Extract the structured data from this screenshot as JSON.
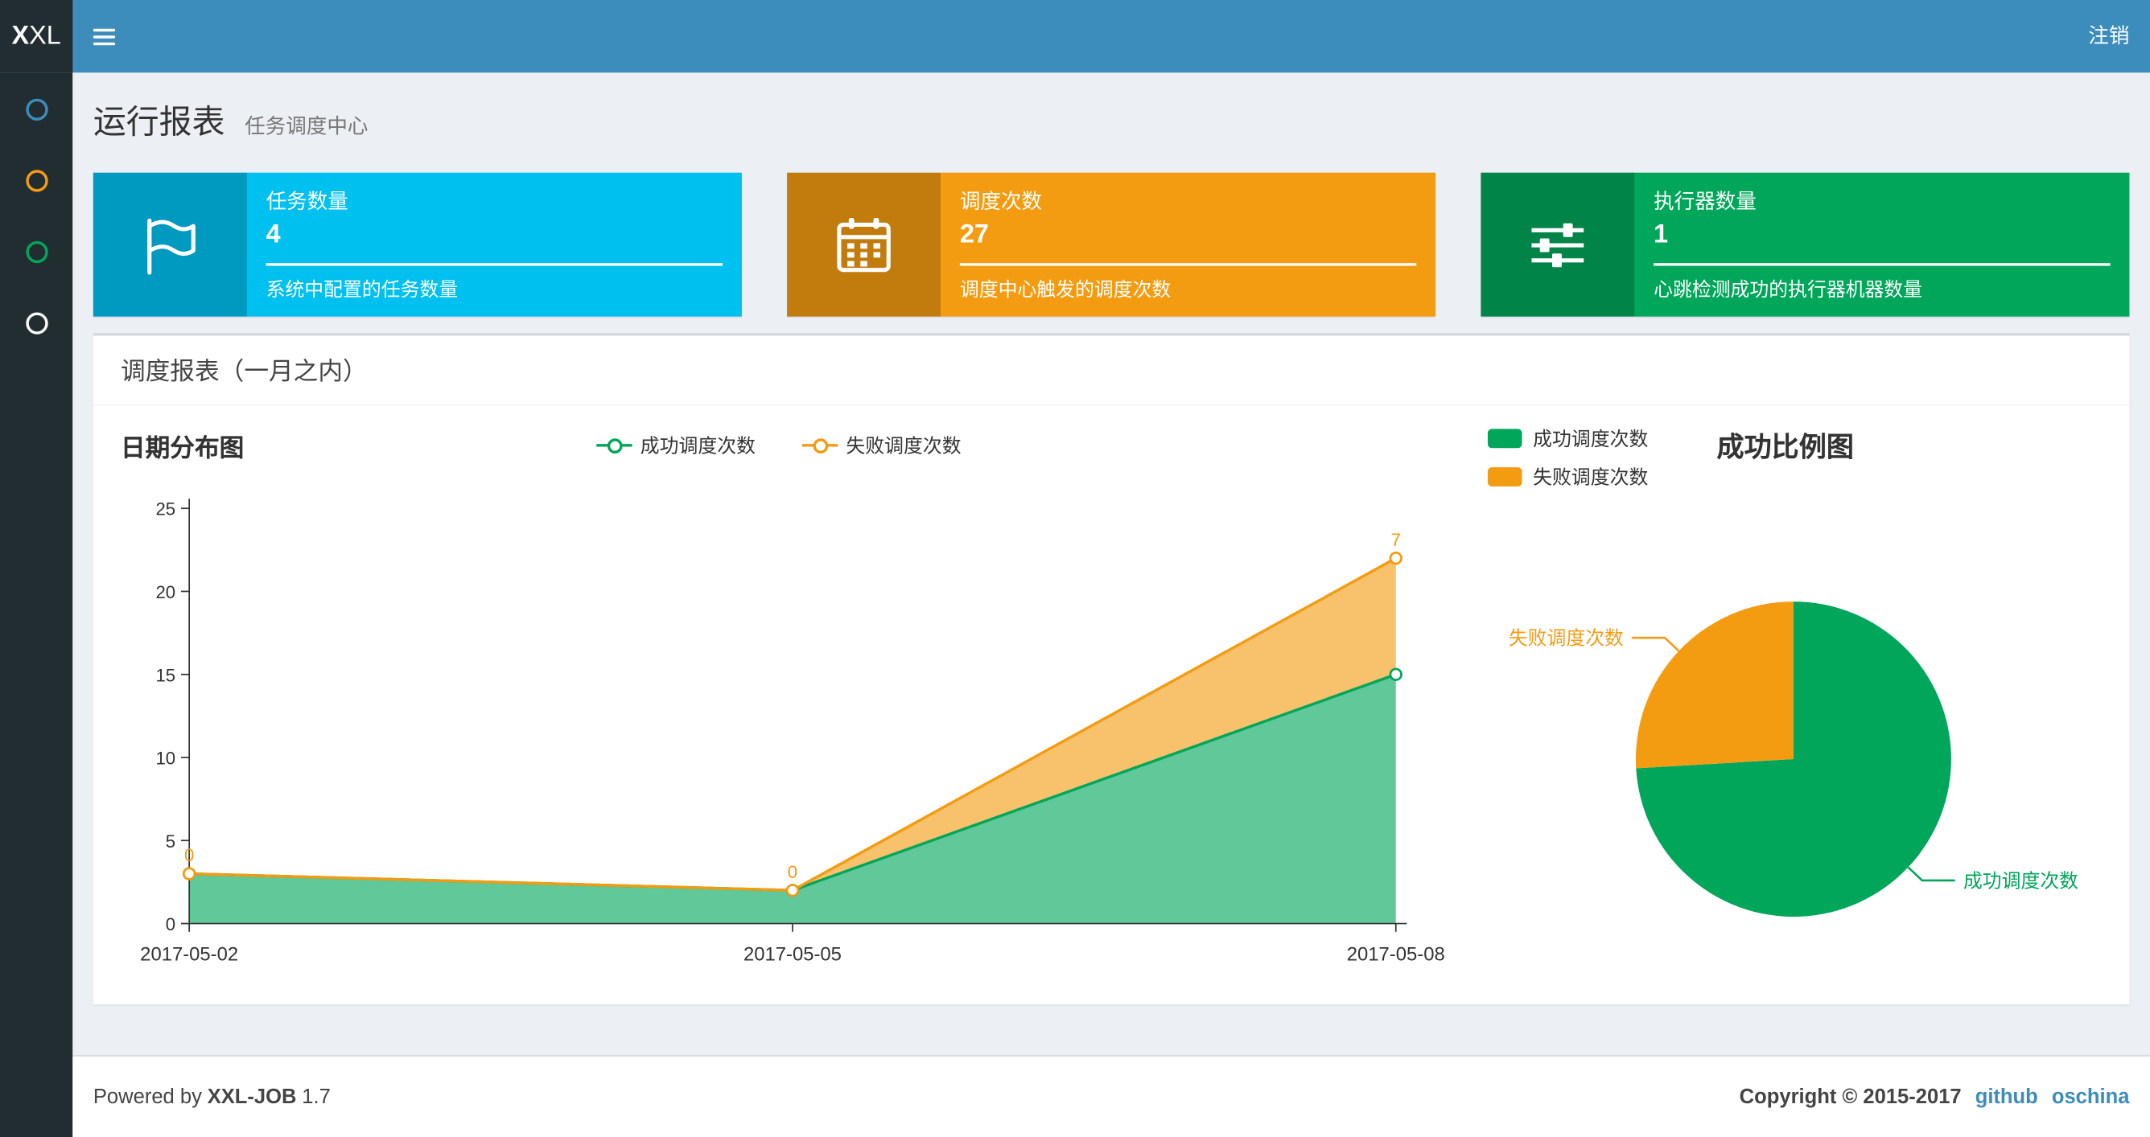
{
  "navbar": {
    "logo": "XXL",
    "logout": "注销"
  },
  "sidebar": {
    "items": [
      {
        "icon": "circle-outline-icon",
        "color": "#3c8dbc"
      },
      {
        "icon": "circle-outline-icon",
        "color": "#f39c12"
      },
      {
        "icon": "circle-outline-icon",
        "color": "#00a65a"
      },
      {
        "icon": "circle-outline-icon",
        "color": "#ffffff"
      }
    ]
  },
  "page_header": {
    "title": "运行报表",
    "subtitle": "任务调度中心"
  },
  "info_boxes": [
    {
      "icon": "flag-icon",
      "bg": "#00c0ef",
      "title": "任务数量",
      "number": "4",
      "desc": "系统中配置的任务数量"
    },
    {
      "icon": "calendar-icon",
      "bg": "#f39c12",
      "title": "调度次数",
      "number": "27",
      "desc": "调度中心触发的调度次数"
    },
    {
      "icon": "sliders-icon",
      "bg": "#00a65a",
      "title": "执行器数量",
      "number": "1",
      "desc": "心跳检测成功的执行器机器数量"
    }
  ],
  "panel": {
    "title": "调度报表（一月之内）"
  },
  "chart_data": [
    {
      "type": "area",
      "title": "日期分布图",
      "categories": [
        "2017-05-02",
        "2017-05-05",
        "2017-05-08"
      ],
      "series": [
        {
          "name": "成功调度次数",
          "color": "#00a65a",
          "values": [
            3,
            2,
            15
          ]
        },
        {
          "name": "失败调度次数",
          "color": "#f39c12",
          "values": [
            0,
            0,
            7
          ],
          "stacked": true,
          "point_labels": [
            "0",
            "0",
            "7"
          ]
        }
      ],
      "ylim": [
        0,
        25
      ],
      "ytick_step": 5,
      "grid": false,
      "legend_position": "top-center"
    },
    {
      "type": "pie",
      "title": "成功比例图",
      "labels": [
        "成功调度次数",
        "失败调度次数"
      ],
      "values": [
        20,
        7
      ],
      "colors": [
        "#00a65a",
        "#f39c12"
      ],
      "legend_position": "top-left"
    }
  ],
  "footer": {
    "powered_prefix": "Powered by",
    "product": "XXL-JOB",
    "version": "1.7",
    "copyright": "Copyright © 2015-2017",
    "links": [
      "github",
      "oschina"
    ]
  }
}
